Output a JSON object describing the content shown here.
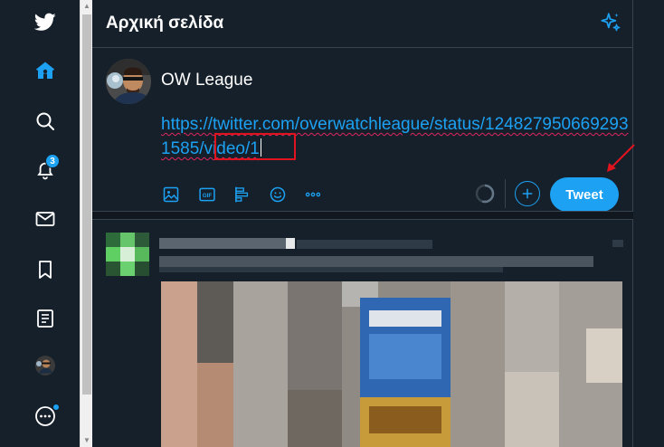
{
  "app": {
    "brand_color": "#1da1f2",
    "bg_color": "#15202b"
  },
  "nav": {
    "items": [
      {
        "icon": "twitter-bird-icon"
      },
      {
        "icon": "home-icon",
        "active": true
      },
      {
        "icon": "explore-search-icon"
      },
      {
        "icon": "notifications-bell-icon",
        "badge": "3"
      },
      {
        "icon": "messages-envelope-icon"
      },
      {
        "icon": "bookmarks-icon"
      },
      {
        "icon": "lists-icon"
      },
      {
        "icon": "profile-avatar"
      },
      {
        "icon": "more-circle-icon",
        "has_dot": true
      }
    ]
  },
  "header": {
    "title": "Αρχική σελίδα"
  },
  "composer": {
    "line1": "OW League",
    "link_part": "https://twitter.com/overwatchleague/status/1248279506692931585",
    "link_suffix": "/video/1",
    "tweet_label": "Tweet",
    "tools": [
      "image-icon",
      "gif-icon",
      "poll-icon",
      "emoji-icon",
      "more-icon"
    ],
    "gif_text": "GIF",
    "char_progress": 0.55
  }
}
